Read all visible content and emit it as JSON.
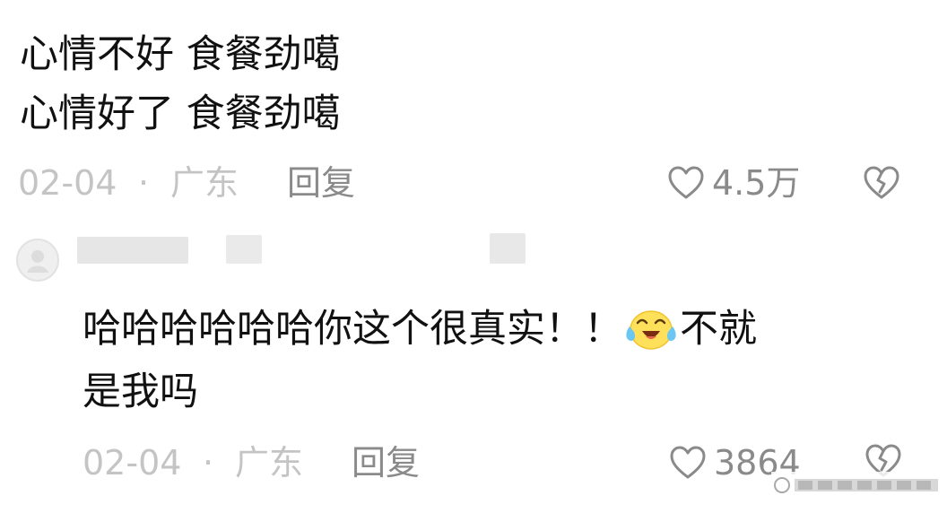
{
  "comment_1": {
    "lines": [
      "心情不好 食餐劲噶",
      "心情好了 食餐劲噶"
    ],
    "date": "02-04",
    "separator": "·",
    "location": "广东",
    "reply_label": "回复",
    "like_count": "4.5万"
  },
  "comment_2": {
    "text_line_1": "哈哈哈哈哈哈你这个很真实！！",
    "emoji_name": "laughing-crying-emoji",
    "text_line_1_tail": "不就",
    "text_line_2": "是我吗",
    "date": "02-04",
    "separator": "·",
    "location": "广东",
    "reply_label": "回复",
    "like_count": "3864"
  },
  "icons": {
    "like": "heart-outline-icon",
    "dislike": "broken-heart-icon"
  }
}
